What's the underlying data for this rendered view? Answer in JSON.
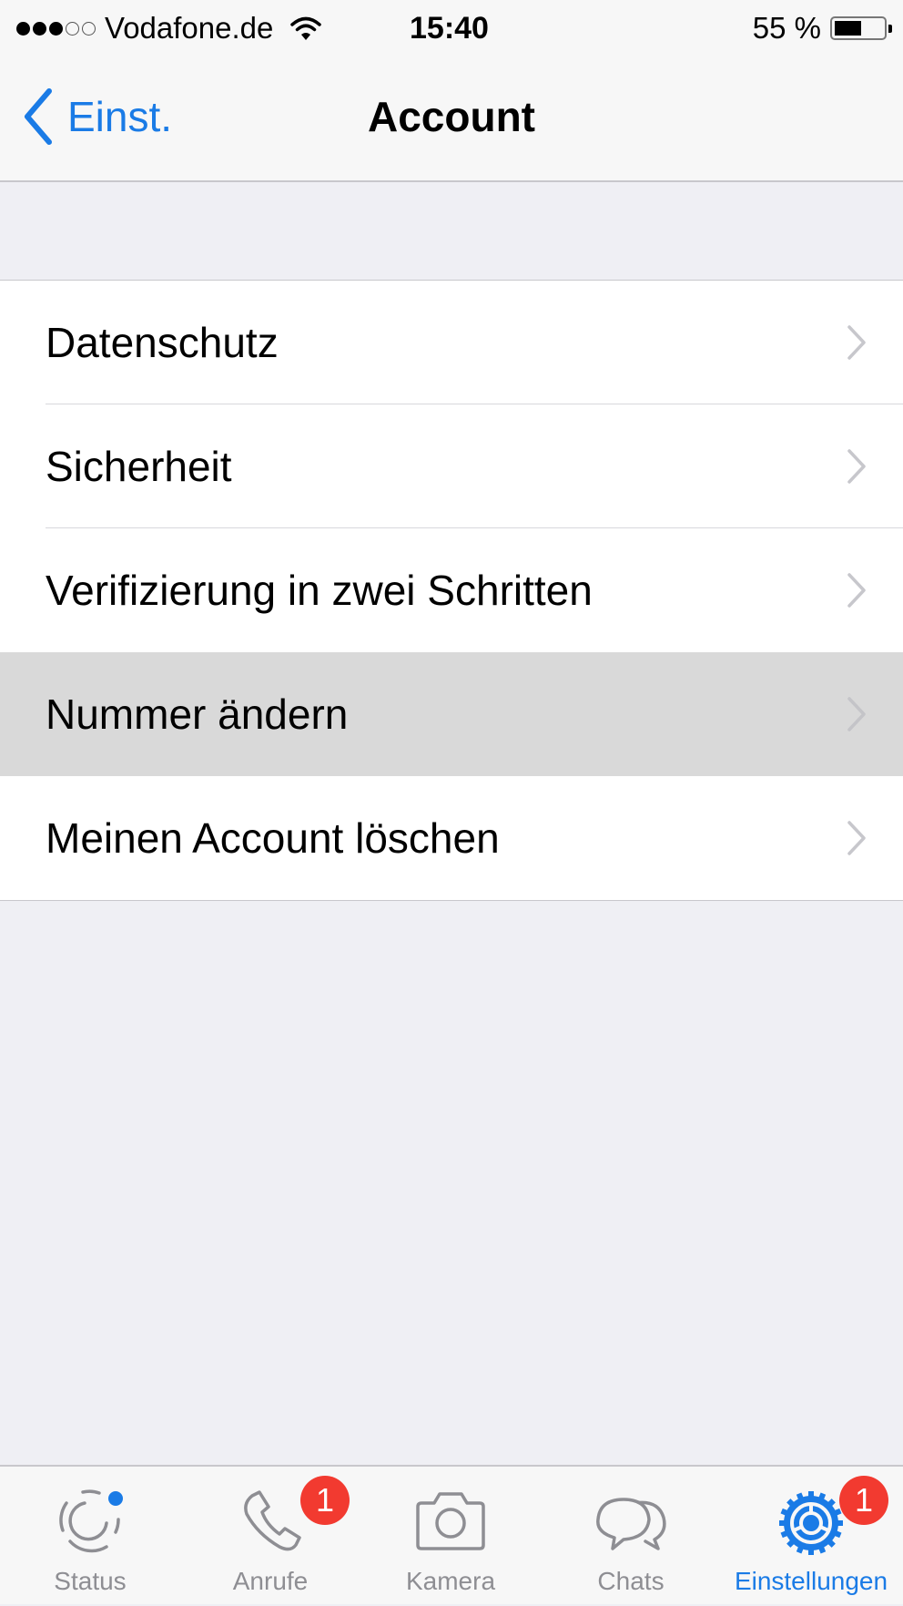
{
  "status_bar": {
    "signal_filled": 3,
    "signal_total": 5,
    "carrier": "Vodafone.de",
    "time": "15:40",
    "battery_text": "55 %",
    "battery_level": 0.55
  },
  "nav": {
    "back_label": "Einst.",
    "title": "Account"
  },
  "list": {
    "items": [
      {
        "label": "Datenschutz",
        "highlighted": false
      },
      {
        "label": "Sicherheit",
        "highlighted": false
      },
      {
        "label": "Verifizierung in zwei Schritten",
        "highlighted": false
      },
      {
        "label": "Nummer ändern",
        "highlighted": true
      },
      {
        "label": "Meinen Account löschen",
        "highlighted": false
      }
    ]
  },
  "tab_bar": {
    "active_color": "#1a7be6",
    "badge_color": "#f23a30",
    "tabs": [
      {
        "label": "Status",
        "icon": "status-icon",
        "active": false,
        "dot": true
      },
      {
        "label": "Anrufe",
        "icon": "phone-icon",
        "active": false,
        "badge": "1"
      },
      {
        "label": "Kamera",
        "icon": "camera-icon",
        "active": false
      },
      {
        "label": "Chats",
        "icon": "chats-icon",
        "active": false
      },
      {
        "label": "Einstellungen",
        "icon": "gear-icon",
        "active": true,
        "badge": "1"
      }
    ]
  }
}
